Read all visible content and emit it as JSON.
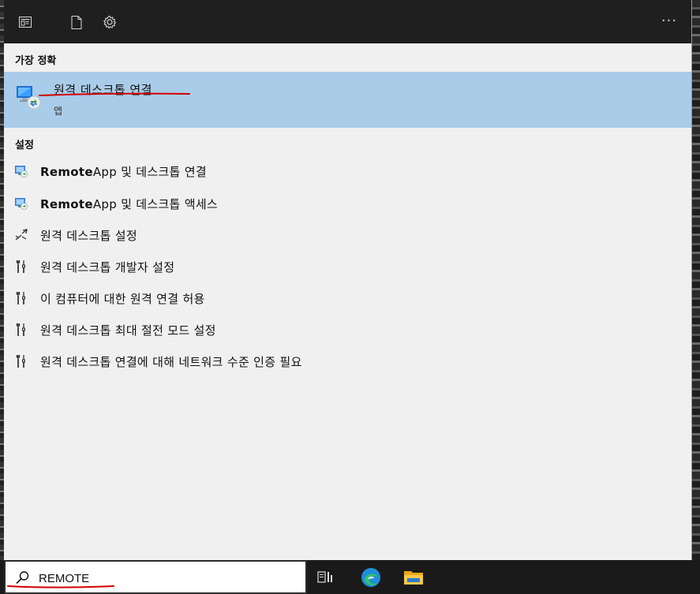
{
  "toolbar": {
    "icons": [
      "apps-icon",
      "document-icon",
      "settings-icon"
    ],
    "more_label": "···"
  },
  "best_match": {
    "heading": "가장 정확",
    "title": "원격 데스크톱 연결",
    "subtitle": "앱",
    "icon": "remote-desktop-icon"
  },
  "settings_section": {
    "heading": "설정",
    "items": [
      {
        "bold": "Remote",
        "rest": "App 및 데스크톱 연결",
        "icon": "remoteapp-icon"
      },
      {
        "bold": "Remote",
        "rest": "App 및 데스크톱 액세스",
        "icon": "remoteapp-icon"
      },
      {
        "bold": "",
        "rest": "원격 데스크톱 설정",
        "icon": "remote-arrows-icon"
      },
      {
        "bold": "",
        "rest": "원격 데스크톱 개발자 설정",
        "icon": "developer-tools-icon"
      },
      {
        "bold": "",
        "rest": "이 컴퓨터에 대한 원격 연결 허용",
        "icon": "developer-tools-icon"
      },
      {
        "bold": "",
        "rest": "원격 데스크톱 최대 절전 모드 설정",
        "icon": "developer-tools-icon"
      },
      {
        "bold": "",
        "rest": "원격 데스크톱 연결에 대해 네트워크 수준 인증 필요",
        "icon": "developer-tools-icon"
      }
    ]
  },
  "search": {
    "value": "REMOTE",
    "icon": "search-icon"
  },
  "taskbar": {
    "buttons": [
      "task-view-icon",
      "edge-browser-icon",
      "file-explorer-icon"
    ]
  },
  "colors": {
    "selection": "#a9cce9",
    "panel": "#f0f0f0",
    "topbar": "#1f1f1f",
    "annotation": "#d40000"
  }
}
